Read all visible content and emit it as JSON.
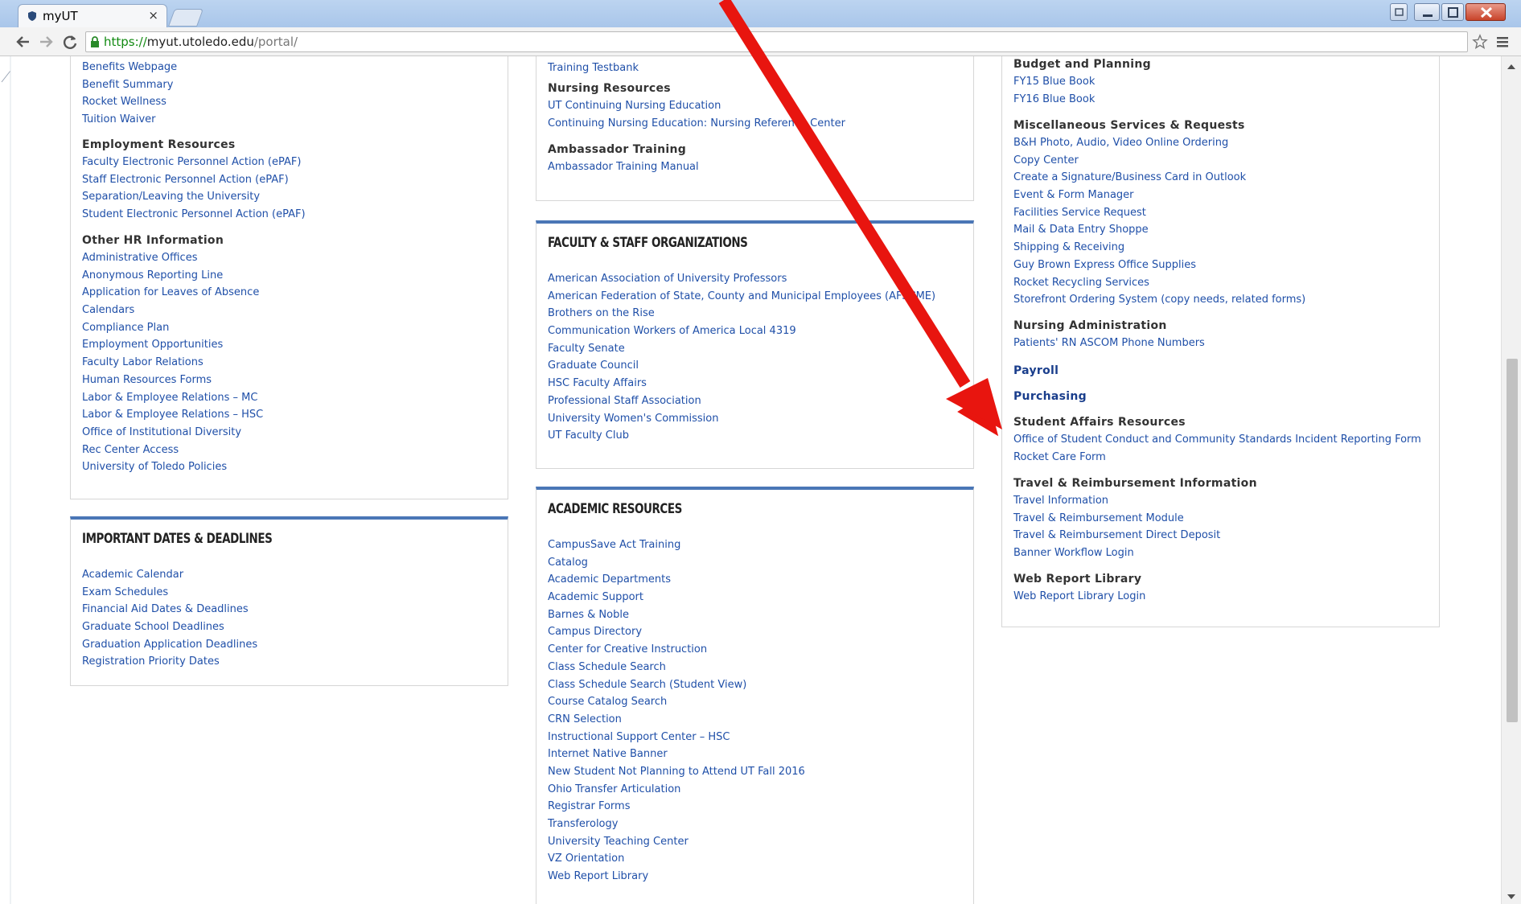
{
  "browser": {
    "tab_title": "myUT",
    "tab_close": "×",
    "url_scheme": "https://",
    "url_host": "myut.utoledo.edu",
    "url_path": "/portal/"
  },
  "left_column": {
    "top_panel": {
      "links_top": [
        "Benefits Webpage",
        "Benefit Summary",
        "Rocket Wellness",
        "Tuition Waiver"
      ],
      "employment": {
        "title": "Employment Resources",
        "links": [
          "Faculty Electronic Personnel Action (ePAF)",
          "Staff Electronic Personnel Action (ePAF)",
          "Separation/Leaving the University",
          "Student Electronic Personnel Action (ePAF)"
        ]
      },
      "other_hr": {
        "title": "Other HR Information",
        "links": [
          "Administrative Offices",
          "Anonymous Reporting Line",
          "Application for Leaves of Absence",
          "Calendars",
          "Compliance Plan",
          "Employment Opportunities",
          "Faculty Labor Relations",
          "Human Resources Forms",
          "Labor & Employee Relations – MC",
          "Labor & Employee Relations – HSC",
          "Office of Institutional Diversity",
          "Rec Center Access",
          "University of Toledo Policies"
        ]
      }
    },
    "dates_panel": {
      "heading": "IMPORTANT DATES & DEADLINES",
      "links": [
        "Academic Calendar",
        "Exam Schedules",
        "Financial Aid Dates & Deadlines",
        "Graduate School Deadlines",
        "Graduation Application Deadlines",
        "Registration Priority Dates"
      ]
    }
  },
  "middle_column": {
    "top_panel": {
      "links_top": [
        "Training Testbank"
      ],
      "nursing": {
        "title": "Nursing Resources",
        "links": [
          "UT Continuing Nursing Education",
          "Continuing Nursing Education: Nursing Reference Center"
        ]
      },
      "ambassador": {
        "title": "Ambassador Training",
        "links": [
          "Ambassador Training Manual"
        ]
      }
    },
    "orgs_panel": {
      "heading": "FACULTY & STAFF ORGANIZATIONS",
      "links": [
        "American Association of University Professors",
        "American Federation of State, County and Municipal Employees (AFSCME)",
        "Brothers on the Rise",
        "Communication Workers of America Local 4319",
        "Faculty Senate",
        "Graduate Council",
        "HSC Faculty Affairs",
        "Professional Staff Association",
        "University Women's Commission",
        "UT Faculty Club"
      ]
    },
    "academic_panel": {
      "heading": "ACADEMIC RESOURCES",
      "links": [
        "CampusSave Act Training",
        "Catalog",
        "Academic Departments",
        "Academic Support",
        "Barnes & Noble",
        "Campus Directory",
        "Center for Creative Instruction",
        "Class Schedule Search",
        "Class Schedule Search (Student View)",
        "Course Catalog Search",
        "CRN Selection",
        "Instructional Support Center – HSC",
        "Internet Native Banner",
        "New Student Not Planning to Attend UT Fall 2016",
        "Ohio Transfer Articulation",
        "Registrar Forms",
        "Transferology",
        "University Teaching Center",
        "VZ Orientation",
        "Web Report Library"
      ]
    }
  },
  "right_column": {
    "budget": {
      "title": "Budget and Planning",
      "links": [
        "FY15 Blue Book",
        "FY16 Blue Book"
      ]
    },
    "misc": {
      "title": "Miscellaneous Services & Requests",
      "links": [
        "B&H Photo, Audio, Video Online Ordering",
        "Copy Center",
        "Create a Signature/Business Card in Outlook",
        "Event & Form Manager",
        "Facilities Service Request",
        "Mail & Data Entry Shoppe",
        "Shipping & Receiving",
        "Guy Brown Express Office Supplies",
        "Rocket Recycling Services",
        "Storefront Ordering System (copy needs, related forms)"
      ]
    },
    "nursing_admin": {
      "title": "Nursing Administration",
      "links": [
        "Patients' RN ASCOM Phone Numbers"
      ]
    },
    "payroll": "Payroll",
    "purchasing": "Purchasing",
    "student_affairs": {
      "title": "Student Affairs Resources",
      "links": [
        "Office of Student Conduct and Community Standards Incident Reporting Form",
        "Rocket Care Form"
      ]
    },
    "travel": {
      "title": "Travel & Reimbursement Information",
      "links": [
        "Travel Information",
        "Travel & Reimbursement Module",
        "Travel & Reimbursement Direct Deposit",
        "Banner Workflow Login"
      ]
    },
    "web_report": {
      "title": "Web Report Library",
      "links": [
        "Web Report Library Login"
      ]
    }
  },
  "colors": {
    "link": "#1f4fa8",
    "panel_bar": "#4a76b6",
    "annotation_arrow": "#e8150f"
  },
  "icons": [
    "shield-favicon-icon",
    "back-arrow-icon",
    "forward-arrow-icon",
    "reload-icon",
    "lock-icon",
    "bookmark-star-icon",
    "menu-icon",
    "minimize-icon",
    "maximize-icon",
    "close-icon"
  ]
}
